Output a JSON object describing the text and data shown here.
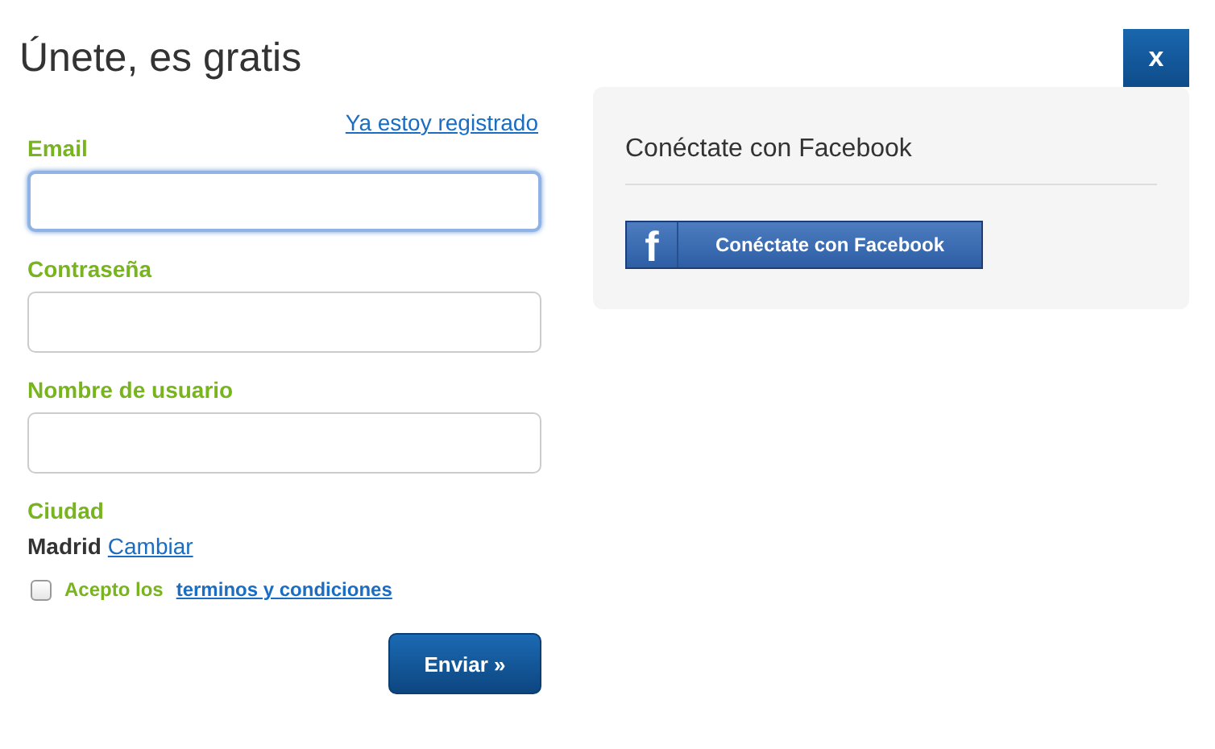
{
  "title": "Únete, es gratis",
  "close_button": "x",
  "login_link": "Ya estoy registrado",
  "fields": [
    {
      "label": "Email",
      "focused": true
    },
    {
      "label": "Contraseña",
      "focused": false
    },
    {
      "label": "Nombre de usuario",
      "focused": false
    }
  ],
  "city": {
    "label": "Ciudad",
    "value": "Madrid",
    "change_link": "Cambiar"
  },
  "terms": {
    "checked": false,
    "text": "Acepto los",
    "link": "terminos y condiciones"
  },
  "submit_button": "Enviar »",
  "facebook_panel": {
    "heading": "Conéctate con Facebook",
    "button_icon": "f",
    "button": "Conéctate con Facebook"
  }
}
